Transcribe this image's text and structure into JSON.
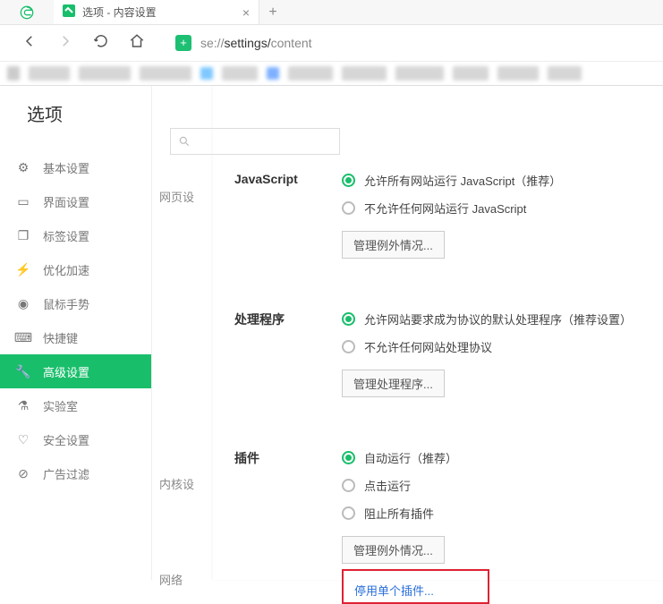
{
  "tab": {
    "title": "选项 - 内容设置"
  },
  "url": {
    "prefix": "se://",
    "mid": "settings/",
    "leaf": "content"
  },
  "pageTitle": "选项",
  "search": {
    "placeholder": ""
  },
  "sidenav": [
    {
      "label": "基本设置",
      "icon": "gear"
    },
    {
      "label": "界面设置",
      "icon": "window"
    },
    {
      "label": "标签设置",
      "icon": "tabs"
    },
    {
      "label": "优化加速",
      "icon": "bolt"
    },
    {
      "label": "鼠标手势",
      "icon": "mouse"
    },
    {
      "label": "快捷键",
      "icon": "keyboard"
    },
    {
      "label": "高级设置",
      "icon": "wrench",
      "active": true
    },
    {
      "label": "实验室",
      "icon": "flask"
    },
    {
      "label": "安全设置",
      "icon": "shield"
    },
    {
      "label": "广告过滤",
      "icon": "block"
    }
  ],
  "sections": {
    "webContent": "网页设",
    "kernel": "内核设",
    "network": "网络"
  },
  "js": {
    "title": "JavaScript",
    "opt1": "允许所有网站运行 JavaScript（推荐）",
    "opt2": "不允许任何网站运行 JavaScript",
    "btn": "管理例外情况..."
  },
  "handler": {
    "title": "处理程序",
    "opt1": "允许网站要求成为协议的默认处理程序（推荐设置）",
    "opt2": "不允许任何网站处理协议",
    "btn": "管理处理程序..."
  },
  "plugin": {
    "title": "插件",
    "opt1": "自动运行（推荐）",
    "opt2": "点击运行",
    "opt3": "阻止所有插件",
    "btn": "管理例外情况...",
    "link": "停用单个插件..."
  }
}
